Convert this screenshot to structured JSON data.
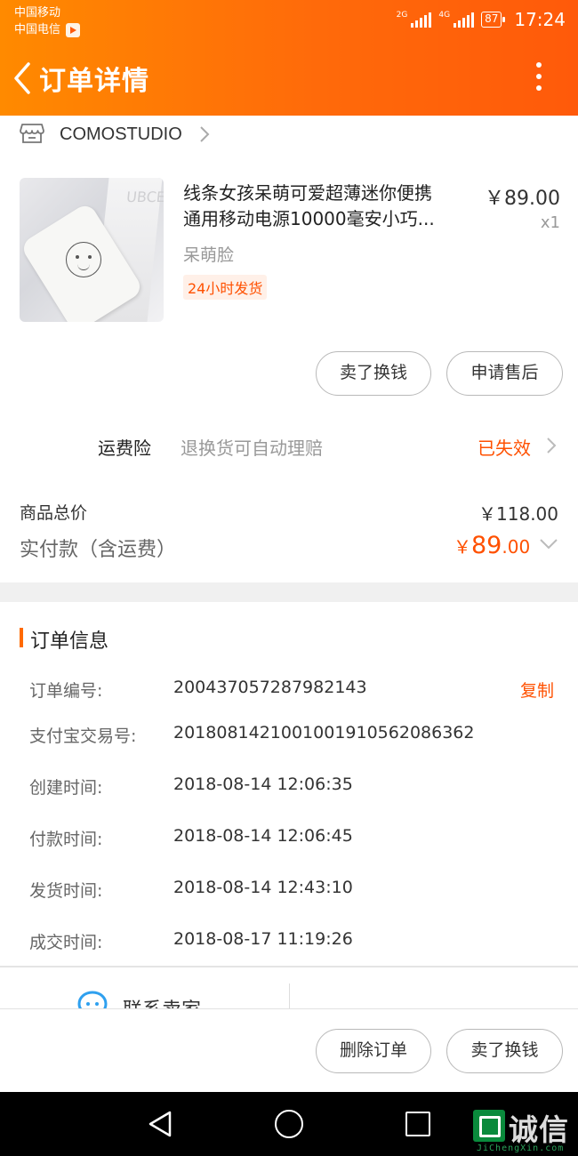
{
  "status_bar": {
    "carrier1": "中国移动",
    "carrier2": "中国电信",
    "net1": "2G",
    "net2": "4G",
    "battery": "87",
    "time": "17:24"
  },
  "nav": {
    "title": "订单详情"
  },
  "shop": {
    "name": "COMOSTUDIO"
  },
  "product": {
    "title_line1": "线条女孩呆萌可爱超薄迷你便携",
    "title_line2": "通用移动电源10000毫安小巧...",
    "price": "￥89.00",
    "quantity": "x1",
    "sku": "呆萌脸",
    "shipping_tag": "24小时发货",
    "image_text": "UBCEO"
  },
  "product_actions": {
    "sell_label": "卖了换钱",
    "aftersale_label": "申请售后"
  },
  "insurance": {
    "label": "运费险",
    "description": "退换货可自动理赔",
    "status": "已失效"
  },
  "totals": {
    "goods_total_label": "商品总价",
    "goods_total_value": "￥118.00",
    "paid_label": "实付款（含运费）",
    "paid_currency": "￥",
    "paid_integer": "89",
    "paid_decimal": ".00"
  },
  "order_info": {
    "title": "订单信息",
    "copy_label": "复制",
    "rows": [
      {
        "label": "订单编号:",
        "value": "200437057287982143"
      },
      {
        "label": "支付宝交易号:",
        "value": "2018081421001001910562086362"
      },
      {
        "label": "创建时间:",
        "value": "2018-08-14 12:06:35"
      },
      {
        "label": "付款时间:",
        "value": "2018-08-14 12:06:45"
      },
      {
        "label": "发货时间:",
        "value": "2018-08-14 12:43:10"
      },
      {
        "label": "成交时间:",
        "value": "2018-08-17 11:19:26"
      }
    ]
  },
  "contact": {
    "label": "联系卖家"
  },
  "bottom_actions": {
    "delete_label": "删除订单",
    "sell_label": "卖了换钱"
  },
  "watermark": {
    "text": "诚信",
    "url": "JiChengXin.com"
  },
  "colors": {
    "accent": "#ff5000",
    "header_start": "#ff8a00",
    "header_end": "#ff5a0a"
  },
  "icons": [
    "back-icon",
    "more-icon",
    "shop-icon",
    "chevron-right-icon",
    "chevron-down-icon",
    "chat-icon"
  ]
}
